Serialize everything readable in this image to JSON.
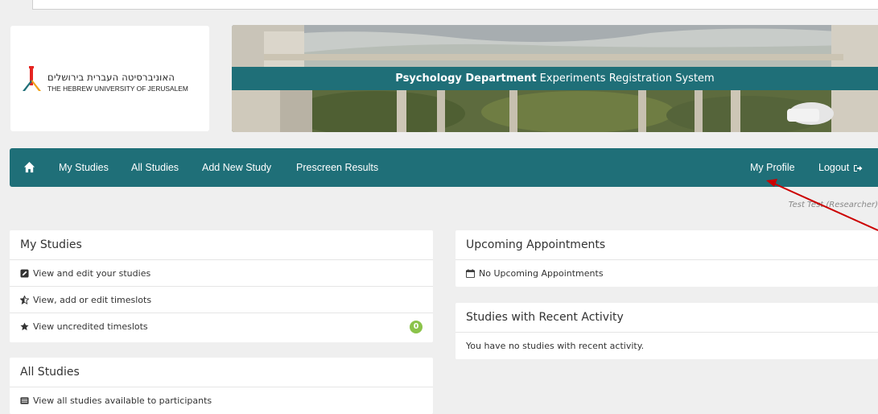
{
  "logo": {
    "hebrew_name": "האוניברסיטה העברית בירושלים",
    "english_name": "THE HEBREW UNIVERSITY OF JERUSALEM"
  },
  "banner": {
    "title_bold": "Psychology Department",
    "title_rest": " Experiments Registration System"
  },
  "nav": {
    "home_icon": "home-icon",
    "items": [
      "My Studies",
      "All Studies",
      "Add New Study",
      "Prescreen Results"
    ],
    "profile": "My Profile",
    "logout": "Logout",
    "logout_icon": "sign-out-icon"
  },
  "user": {
    "line": "Test Test (Researcher)"
  },
  "my_studies": {
    "title": "My Studies",
    "rows": [
      {
        "label": "View and edit your studies",
        "icon": "edit-icon"
      },
      {
        "label": "View, add or edit timeslots",
        "icon": "star-half-icon"
      },
      {
        "label": "View uncredited timeslots",
        "icon": "star-icon",
        "badge": "0"
      }
    ]
  },
  "all_studies": {
    "title": "All Studies",
    "rows": [
      {
        "label": "View all studies available to participants",
        "icon": "list-icon"
      }
    ]
  },
  "upcoming": {
    "title": "Upcoming Appointments",
    "rows": [
      {
        "label": "No Upcoming Appointments",
        "icon": "calendar-icon"
      }
    ]
  },
  "recent": {
    "title": "Studies with Recent Activity",
    "rows": [
      {
        "label": "You have no studies with recent activity."
      }
    ]
  },
  "colors": {
    "brand_teal": "#1f6f78",
    "badge_green": "#8bc34a",
    "annotation_arrow": "#cc0000",
    "page_bg": "#efefef"
  }
}
